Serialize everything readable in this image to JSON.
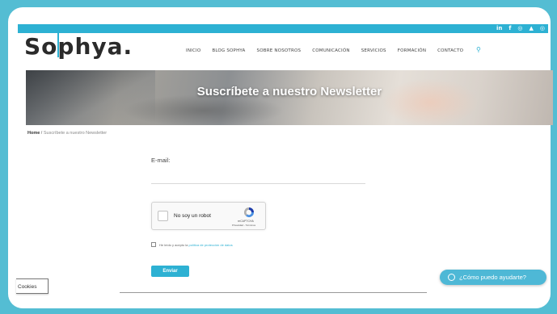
{
  "header": {
    "logo_text": "Sophya.",
    "social_icons": [
      "linkedin-icon",
      "facebook-icon",
      "instagram-icon",
      "youtube-icon",
      "instagram-alt-icon"
    ],
    "social_glyphs": [
      "in",
      "f",
      "◎",
      "▲",
      "◎"
    ]
  },
  "nav": {
    "items": [
      "INICIO",
      "BLOG SOPHYA",
      "SOBRE NOSOTROS",
      "COMUNICACIÓN",
      "SERVICIOS",
      "FORMACIÓN",
      "CONTACTO"
    ],
    "search_icon": "search-icon",
    "search_glyph": "⚲"
  },
  "hero": {
    "title": "Suscríbete a nuestro Newsletter"
  },
  "breadcrumb": {
    "home": "Home",
    "separator": " / ",
    "current": "Suscríbete a nuestro Newsletter"
  },
  "form": {
    "email_label": "E-mail:",
    "email_value": "",
    "recaptcha_label": "No soy un robot",
    "recaptcha_brand": "reCAPTCHA",
    "recaptcha_terms": "Privacidad - Términos",
    "privacy_text": "He leído y acepto la ",
    "privacy_link": "política de protección de datos",
    "submit_label": "Enviar"
  },
  "cookies": {
    "label": "Cookies"
  },
  "chat": {
    "label": "¿Cómo puedo ayudarte?",
    "icon": "whatsapp-icon"
  },
  "colors": {
    "accent": "#2db1d3",
    "background": "#54bdd3",
    "chat": "#4eb8d6"
  }
}
